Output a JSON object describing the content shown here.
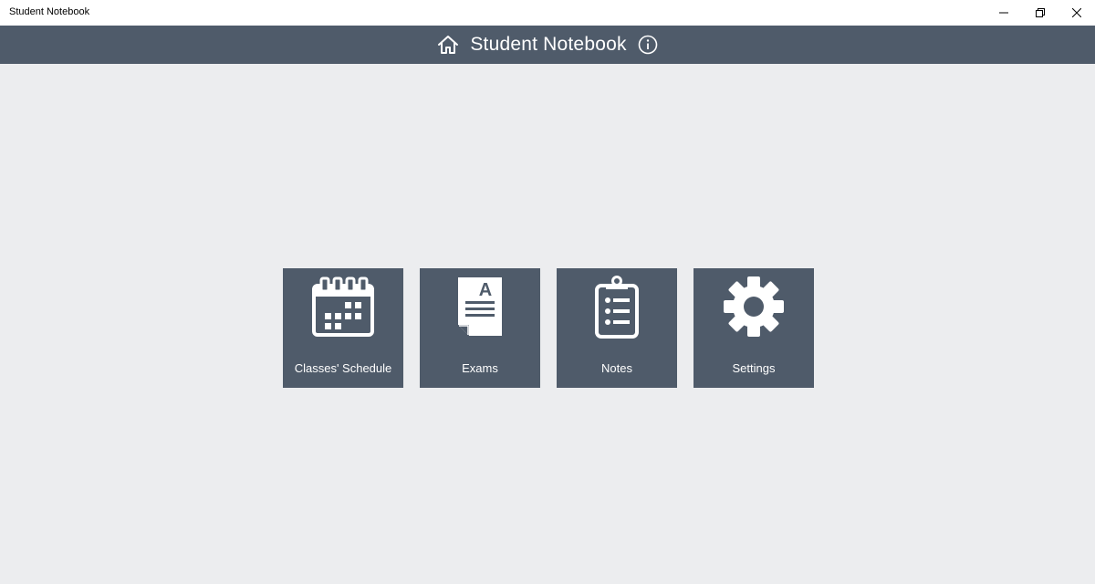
{
  "window": {
    "title": "Student Notebook",
    "controls": {
      "minimize": "minimize-icon",
      "restore": "restore-icon",
      "close": "close-icon"
    }
  },
  "header": {
    "title": "Student Notebook",
    "home_icon": "home-icon",
    "info_icon": "info-icon"
  },
  "tiles": [
    {
      "label": "Classes' Schedule",
      "icon": "calendar-icon"
    },
    {
      "label": "Exams",
      "icon": "exam-document-icon"
    },
    {
      "label": "Notes",
      "icon": "clipboard-list-icon"
    },
    {
      "label": "Settings",
      "icon": "gear-icon"
    }
  ],
  "colors": {
    "header_bg": "#4f5b6a",
    "tile_bg": "#4f5b6a",
    "page_bg": "#ecedef",
    "text_light": "#ffffff"
  }
}
